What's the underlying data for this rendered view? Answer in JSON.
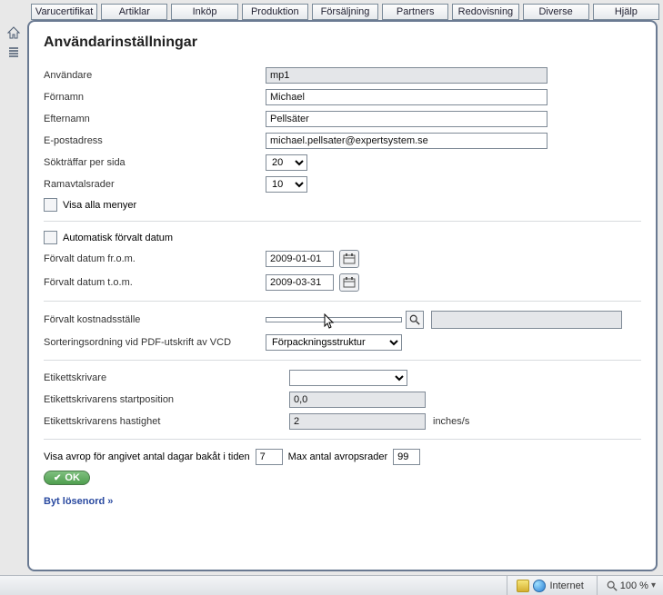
{
  "tabs": [
    "Varucertifikat",
    "Artiklar",
    "Inköp",
    "Produktion",
    "Försäljning",
    "Partners",
    "Redovisning",
    "Diverse",
    "Hjälp"
  ],
  "title": "Användarinställningar",
  "labels": {
    "user": "Användare",
    "first": "Förnamn",
    "last": "Efternamn",
    "email": "E-postadress",
    "hits": "Sökträffar per sida",
    "framerows": "Ramavtalsrader",
    "showall": "Visa alla menyer",
    "autodate": "Automatisk förvalt datum",
    "datefrom": "Förvalt datum fr.o.m.",
    "dateto": "Förvalt datum t.o.m.",
    "costcentre": "Förvalt kostnadsställe",
    "sortpdf": "Sorteringsordning vid PDF-utskrift av VCD",
    "printer": "Etikettskrivare",
    "printerstart": "Etikettskrivarens startposition",
    "printerspeed": "Etikettskrivarens hastighet",
    "speedunit": "inches/s",
    "avrop_pre": "Visa avrop för angivet antal dagar bakåt i tiden",
    "avrop_mid": "Max antal avropsrader",
    "ok": "OK",
    "pwlink": "Byt lösenord »"
  },
  "values": {
    "user": "mp1",
    "first": "Michael",
    "last": "Pellsäter",
    "email": "michael.pellsater@expertsystem.se",
    "hits": "20",
    "framerows": "10",
    "datefrom": "2009-01-01",
    "dateto": "2009-03-31",
    "sortpdf": "Förpackningsstruktur",
    "printerstart": "0,0",
    "printerspeed": "2",
    "avrop_days": "7",
    "avrop_max": "99"
  },
  "status": {
    "zone": "Internet",
    "zoom": "100 %"
  }
}
